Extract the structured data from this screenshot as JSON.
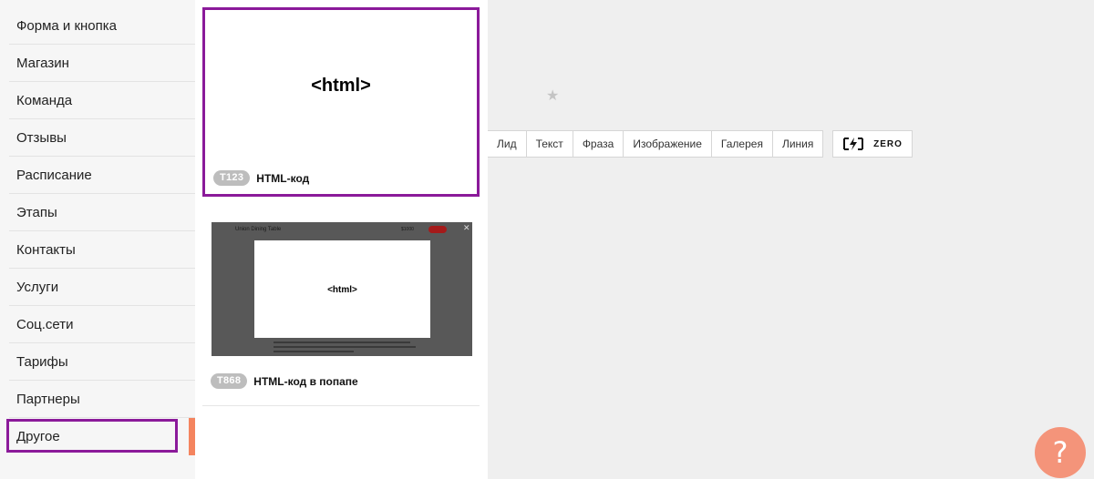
{
  "sidebar": {
    "items": [
      {
        "label": "Форма и кнопка"
      },
      {
        "label": "Магазин"
      },
      {
        "label": "Команда"
      },
      {
        "label": "Отзывы"
      },
      {
        "label": "Расписание"
      },
      {
        "label": "Этапы"
      },
      {
        "label": "Контакты"
      },
      {
        "label": "Услуги"
      },
      {
        "label": "Соц.сети"
      },
      {
        "label": "Тарифы"
      },
      {
        "label": "Партнеры"
      },
      {
        "label": "Другое"
      }
    ],
    "active_index": 11
  },
  "blocks": [
    {
      "code": "T123",
      "title": "HTML-код",
      "preview_text": "<html>"
    },
    {
      "code": "T868",
      "title": "HTML-код в попапе",
      "preview_text": "<html>"
    }
  ],
  "toolbar": {
    "types": [
      "Лид",
      "Текст",
      "Фраза",
      "Изображение",
      "Галерея",
      "Линия"
    ],
    "zero_label": "ZERO"
  },
  "icons": {
    "star": "star-icon",
    "zero": "zero-block-icon",
    "help": "question-mark-icon"
  },
  "help": {
    "label": "?"
  },
  "colors": {
    "highlight": "#8b1a9a",
    "accent": "#f4845f",
    "help_button": "#f4947a"
  }
}
